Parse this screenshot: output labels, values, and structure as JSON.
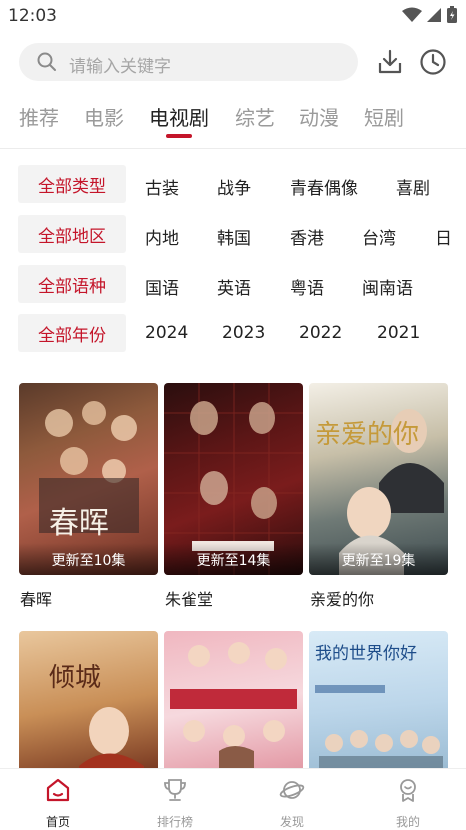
{
  "status_bar": {
    "time": "12:03"
  },
  "search": {
    "placeholder": "请输入关键字"
  },
  "tabs": [
    {
      "label": "推荐"
    },
    {
      "label": "电影"
    },
    {
      "label": "电视剧"
    },
    {
      "label": "综艺"
    },
    {
      "label": "动漫"
    },
    {
      "label": "短剧"
    }
  ],
  "active_tab": "电视剧",
  "filters": [
    {
      "selected": "全部类型",
      "options": [
        "古装",
        "战争",
        "青春偶像",
        "喜剧"
      ]
    },
    {
      "selected": "全部地区",
      "options": [
        "内地",
        "韩国",
        "香港",
        "台湾",
        "日"
      ]
    },
    {
      "selected": "全部语种",
      "options": [
        "国语",
        "英语",
        "粤语",
        "闽南语"
      ]
    },
    {
      "selected": "全部年份",
      "options": [
        "2024",
        "2023",
        "2022",
        "2021"
      ]
    }
  ],
  "shows": [
    {
      "title": "春晖",
      "episode": "更新至10集"
    },
    {
      "title": "朱雀堂",
      "episode": "更新至14集"
    },
    {
      "title": "亲爱的你",
      "episode": "更新至19集"
    },
    {
      "title": "",
      "episode": ""
    },
    {
      "title": "",
      "episode": ""
    },
    {
      "title": "",
      "episode": ""
    }
  ],
  "posters": {
    "p1": "春晖",
    "p3": "亲爱的你",
    "p4": "倾城",
    "p6": "我的世界你好"
  },
  "bottom_nav": [
    {
      "label": "首页"
    },
    {
      "label": "排行榜"
    },
    {
      "label": "发现"
    },
    {
      "label": "我的"
    }
  ],
  "colors": {
    "accent": "#c4152a",
    "muted": "#9a9a9a",
    "chip_bg": "#f3f3f3"
  }
}
